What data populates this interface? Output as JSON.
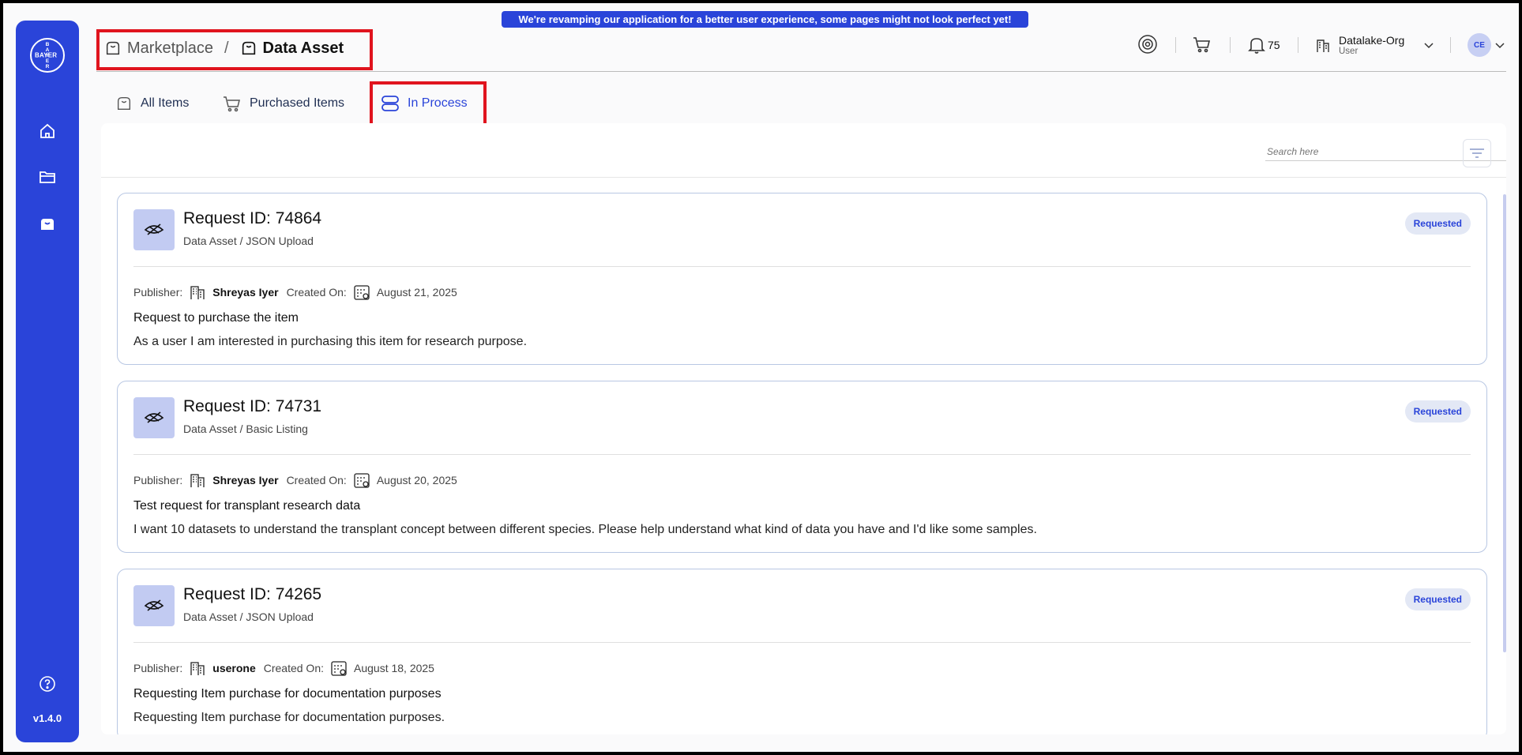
{
  "banner": "We're revamping our application for a better user experience, some pages might not look perfect yet!",
  "sidebar": {
    "logo": {
      "vertical": [
        "B",
        "A",
        "Y",
        "E",
        "R"
      ],
      "horizontal": "BAYER"
    },
    "version": "v1.4.0"
  },
  "breadcrumb": {
    "root": "Marketplace",
    "separator": "/",
    "current": "Data Asset"
  },
  "header": {
    "notifications": "75",
    "org_name": "Datalake-Org",
    "org_role": "User",
    "avatar": "CE"
  },
  "tabs": [
    {
      "label": "All Items",
      "icon": "bag-icon"
    },
    {
      "label": "Purchased Items",
      "icon": "cart-icon"
    },
    {
      "label": "In Process",
      "icon": "process-icon",
      "active": true
    }
  ],
  "search": {
    "placeholder": "Search here"
  },
  "colors": {
    "accent": "#2a44d9",
    "highlight": "#e0141e",
    "badge_bg": "#e3e8f5"
  },
  "requests": [
    {
      "title": "Request ID: 74864",
      "subtitle": "Data Asset / JSON Upload",
      "status": "Requested",
      "publisher_label": "Publisher:",
      "publisher": "Shreyas Iyer",
      "created_label": "Created On:",
      "created": "August 21, 2025",
      "heading": "Request to purchase the item",
      "description": "As a user I am interested in purchasing this item for research purpose."
    },
    {
      "title": "Request ID: 74731",
      "subtitle": "Data Asset / Basic Listing",
      "status": "Requested",
      "publisher_label": "Publisher:",
      "publisher": "Shreyas Iyer",
      "created_label": "Created On:",
      "created": "August 20, 2025",
      "heading": "Test request for transplant research data",
      "description": "I want 10 datasets to understand the transplant concept between different species. Please help understand what kind of data you have and I'd like some samples."
    },
    {
      "title": "Request ID: 74265",
      "subtitle": "Data Asset / JSON Upload",
      "status": "Requested",
      "publisher_label": "Publisher:",
      "publisher": "userone",
      "created_label": "Created On:",
      "created": "August 18, 2025",
      "heading": "Requesting Item purchase for documentation purposes",
      "description": "Requesting Item purchase for documentation purposes."
    }
  ]
}
